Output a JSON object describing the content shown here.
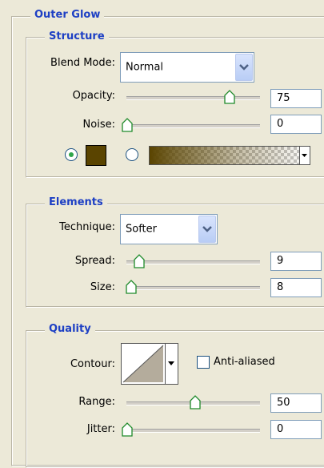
{
  "outer_glow": {
    "title": "Outer Glow",
    "structure": {
      "title": "Structure",
      "blend_mode_label": "Blend Mode:",
      "blend_mode_value": "Normal",
      "opacity_label": "Opacity:",
      "opacity_value": "75",
      "opacity_level": 0.75,
      "noise_label": "Noise:",
      "noise_value": "0",
      "noise_level": 0,
      "glow_color": "#5a4400",
      "color_mode_selected": "solid-color"
    },
    "elements": {
      "title": "Elements",
      "technique_label": "Technique:",
      "technique_value": "Softer",
      "spread_label": "Spread:",
      "spread_value": "9",
      "spread_level": 0.09,
      "size_label": "Size:",
      "size_value": "8",
      "size_level": 0.03
    },
    "quality": {
      "title": "Quality",
      "contour_label": "Contour:",
      "anti_aliased_label": "Anti-aliased",
      "anti_aliased_checked": false,
      "range_label": "Range:",
      "range_value": "50",
      "range_level": 0.5,
      "jitter_label": "Jitter:",
      "jitter_value": "0",
      "jitter_level": 0
    }
  }
}
